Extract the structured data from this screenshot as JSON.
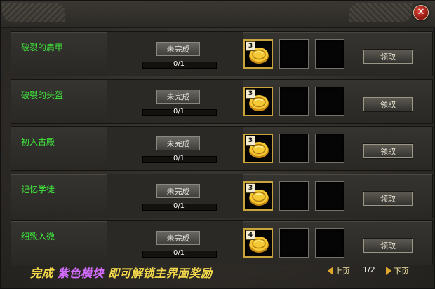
{
  "window": {
    "close_symbol": "✕"
  },
  "tasks": [
    {
      "name": "破裂的肩甲",
      "status": "未完成",
      "progress_text": "0/1",
      "progress": 0,
      "reward_qty": "3",
      "claim": "领取"
    },
    {
      "name": "破裂的头盔",
      "status": "未完成",
      "progress_text": "0/1",
      "progress": 0,
      "reward_qty": "3",
      "claim": "领取"
    },
    {
      "name": "初入古殿",
      "status": "未完成",
      "progress_text": "0/1",
      "progress": 0,
      "reward_qty": "3",
      "claim": "领取"
    },
    {
      "name": "记忆学徒",
      "status": "未完成",
      "progress_text": "0/1",
      "progress": 0,
      "reward_qty": "3",
      "claim": "领取"
    },
    {
      "name": "细致入微",
      "status": "未完成",
      "progress_text": "0/1",
      "progress": 0,
      "reward_qty": "4",
      "claim": "领取"
    }
  ],
  "reward_icon": "gold-coin-icon",
  "footer": {
    "part1": "完成",
    "highlight": "紫色模块",
    "part2": "即可解锁主界面奖励"
  },
  "pager": {
    "prev": "上页",
    "page": "1/2",
    "next": "下页"
  },
  "colors": {
    "task_name": "#3fe83c",
    "highlight": "#d46cff",
    "footer_text": "#f2d84a",
    "slot_border": "#c8a43a"
  }
}
